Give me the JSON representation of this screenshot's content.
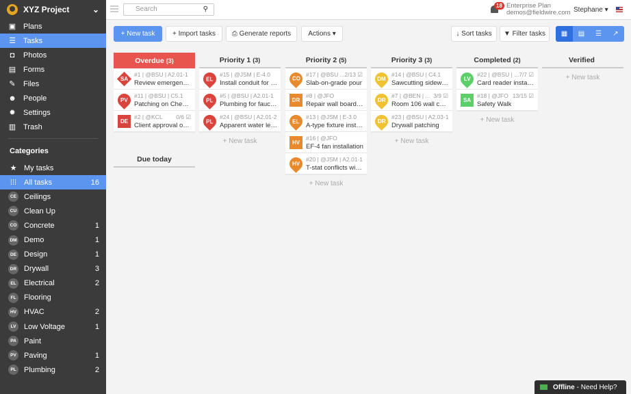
{
  "sidebar": {
    "project": "XYZ Project",
    "nav": [
      {
        "label": "Plans",
        "icon": "plans-icon",
        "glyph": "▣"
      },
      {
        "label": "Tasks",
        "icon": "list-icon",
        "glyph": "☰",
        "active": true
      },
      {
        "label": "Photos",
        "icon": "camera-icon",
        "glyph": "◘"
      },
      {
        "label": "Forms",
        "icon": "clipboard-icon",
        "glyph": "▤"
      },
      {
        "label": "Files",
        "icon": "paperclip-icon",
        "glyph": "✎"
      },
      {
        "label": "People",
        "icon": "people-icon",
        "glyph": "☻"
      },
      {
        "label": "Settings",
        "icon": "gear-icon",
        "glyph": "✹"
      },
      {
        "label": "Trash",
        "icon": "trash-icon",
        "glyph": "▥"
      }
    ],
    "categories_heading": "Categories",
    "my_tasks": "My tasks",
    "all_tasks": "All tasks",
    "all_tasks_count": "16",
    "categories": [
      {
        "code": "CE",
        "label": "Ceilings",
        "count": ""
      },
      {
        "code": "CU",
        "label": "Clean Up",
        "count": ""
      },
      {
        "code": "CO",
        "label": "Concrete",
        "count": "1"
      },
      {
        "code": "DM",
        "label": "Demo",
        "count": "1"
      },
      {
        "code": "DE",
        "label": "Design",
        "count": "1"
      },
      {
        "code": "DR",
        "label": "Drywall",
        "count": "3"
      },
      {
        "code": "EL",
        "label": "Electrical",
        "count": "2"
      },
      {
        "code": "FL",
        "label": "Flooring",
        "count": ""
      },
      {
        "code": "HV",
        "label": "HVAC",
        "count": "2"
      },
      {
        "code": "LV",
        "label": "Low Voltage",
        "count": "1"
      },
      {
        "code": "PA",
        "label": "Paint",
        "count": ""
      },
      {
        "code": "PV",
        "label": "Paving",
        "count": "1"
      },
      {
        "code": "PL",
        "label": "Plumbing",
        "count": "2"
      }
    ]
  },
  "topbar": {
    "search_placeholder": "Search",
    "notifications": "18",
    "plan": "Enterprise Plan",
    "email": "demos@fieldwire.com",
    "user": "Stephane ▾"
  },
  "toolbar": {
    "new_task": "+ New task",
    "import_tasks": "+ Import tasks",
    "generate_reports": "⎙ Generate reports",
    "actions": "Actions ▾",
    "sort_tasks": "↓ Sort tasks",
    "filter_tasks": "▼ Filter tasks",
    "views": [
      "▦",
      "▤",
      "☰",
      "↗"
    ]
  },
  "colors": {
    "overdue": "#e8554f",
    "priority1": "#d9443c",
    "priority2": "#e8892e",
    "priority3": "#f0c232",
    "completed": "#5ccf6a",
    "accent": "#5b95f0"
  },
  "columns": [
    {
      "title": "Overdue",
      "count": "(3)",
      "new_task": "",
      "cards": [
        {
          "code": "SA",
          "shape": "dia",
          "color": "#d9443c",
          "meta": "#1 | @BSU | A2.01-1",
          "prog": "",
          "title": "Review emergency ..."
        },
        {
          "code": "PV",
          "shape": "pin",
          "color": "#d9443c",
          "meta": "#11 | @BSU | C5.1",
          "prog": "",
          "title": "Patching on Chestn..."
        },
        {
          "code": "DE",
          "shape": "sq",
          "color": "#d9443c",
          "meta": "#2 | @KCL",
          "prog": "0/6 ☑",
          "title": "Client approval on c..."
        }
      ]
    },
    {
      "title": "Priority 1",
      "count": "(3)",
      "new_task": "+ New task",
      "cards": [
        {
          "code": "EL",
          "shape": "pin",
          "color": "#d9443c",
          "meta": "#15 | @JSM | E-4.0",
          "prog": "",
          "title": "Install conduit for E..."
        },
        {
          "code": "PL",
          "shape": "pin",
          "color": "#d9443c",
          "meta": "#5 | @BSU | A2.01-1",
          "prog": "",
          "title": "Plumbing for faucet ..."
        },
        {
          "code": "PL",
          "shape": "pin",
          "color": "#d9443c",
          "meta": "#24 | @BSU | A2.01-2",
          "prog": "",
          "title": "Apparent water leak"
        }
      ]
    },
    {
      "title": "Priority 2",
      "count": "(5)",
      "new_task": "+ New task",
      "cards": [
        {
          "code": "CO",
          "shape": "pin",
          "color": "#e8892e",
          "meta": "#17 | @BSU ...",
          "prog": "2/13 ☑",
          "title": "Slab-on-grade pour"
        },
        {
          "code": "DR",
          "shape": "sq",
          "color": "#e8892e",
          "meta": "#8 | @JFO",
          "prog": "",
          "title": "Repair wall board o..."
        },
        {
          "code": "EL",
          "shape": "pin",
          "color": "#e8892e",
          "meta": "#13 | @JSM | E-3.0",
          "prog": "",
          "title": "A-type fixture instal..."
        },
        {
          "code": "HV",
          "shape": "sq",
          "color": "#e8892e",
          "meta": "#16 | @JFO",
          "prog": "",
          "title": "EF-4 fan installation"
        },
        {
          "code": "HV",
          "shape": "pin",
          "color": "#e8892e",
          "meta": "#20 | @JSM | A2.01-1",
          "prog": "",
          "title": "T-stat conflicts with..."
        }
      ]
    },
    {
      "title": "Priority 3",
      "count": "(3)",
      "new_task": "+ New task",
      "cards": [
        {
          "code": "DM",
          "shape": "pin",
          "color": "#f0c232",
          "meta": "#14 | @BSU | C4.1",
          "prog": "",
          "title": "Sawcutting sidewalk..."
        },
        {
          "code": "DR",
          "shape": "pin",
          "color": "#f0c232",
          "meta": "#7 | @BEN | ...",
          "prog": "3/9 ☑",
          "title": "Room 106 wall com..."
        },
        {
          "code": "DR",
          "shape": "pin",
          "color": "#f0c232",
          "meta": "#23 | @BSU | A2.03-1",
          "prog": "",
          "title": "Drywall patching"
        }
      ]
    },
    {
      "title": "Completed",
      "count": "(2)",
      "new_task": "+ New task",
      "cards": [
        {
          "code": "LV",
          "shape": "pin",
          "color": "#5ccf6a",
          "meta": "#22 | @BSU | ...",
          "prog": "7/7 ☑",
          "title": "Card reader installa..."
        },
        {
          "code": "SA",
          "shape": "sq",
          "color": "#5ccf6a",
          "meta": "#18 | @JFO",
          "prog": "13/15 ☑",
          "title": "Safety Walk"
        }
      ]
    },
    {
      "title": "Verified",
      "count": "",
      "new_task": "+ New task",
      "cards": []
    }
  ],
  "due_today": "Due today",
  "help": {
    "status": "Offline",
    "text": "- Need Help?"
  }
}
